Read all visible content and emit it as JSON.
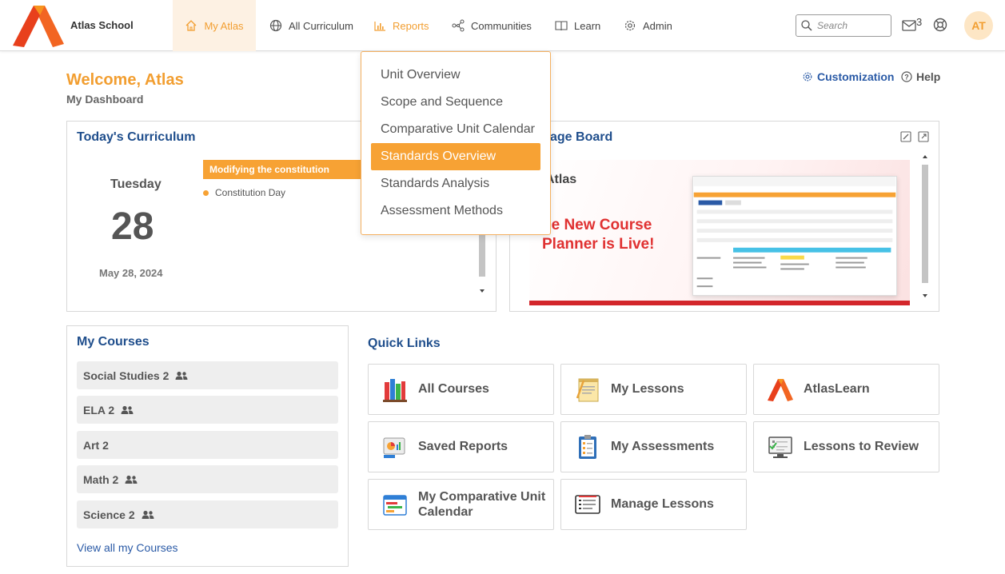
{
  "header": {
    "school_name": "Atlas School",
    "nav": [
      {
        "label": "My Atlas",
        "icon": "home-icon"
      },
      {
        "label": "All Curriculum",
        "icon": "globe-icon"
      },
      {
        "label": "Reports",
        "icon": "bar-chart-icon"
      },
      {
        "label": "Communities",
        "icon": "network-icon"
      },
      {
        "label": "Learn",
        "icon": "book-icon"
      },
      {
        "label": "Admin",
        "icon": "gear-icon"
      }
    ],
    "search_placeholder": "Search",
    "mail_count": "3",
    "avatar_initials": "AT",
    "colors": {
      "accent": "#f29e30",
      "active_bg": "#fdf1e3",
      "link": "#2a5aa6",
      "title": "#1f4e8c"
    }
  },
  "page": {
    "welcome": "Welcome, Atlas",
    "subtitle": "My Dashboard",
    "customization": "Customization",
    "help": "Help"
  },
  "reports_menu": {
    "items": [
      "Unit Overview",
      "Scope and Sequence",
      "Comparative Unit Calendar",
      "Standards Overview",
      "Standards Analysis",
      "Assessment Methods"
    ],
    "selected": "Standards Overview"
  },
  "todays_curriculum": {
    "title": "Today's Curriculum",
    "weekday": "Tuesday",
    "day": "28",
    "full_date": "May 28, 2024",
    "event_title": "Modifying the constitution",
    "event_item": "Constitution Day"
  },
  "message_board": {
    "title_visible": "age Board",
    "banner_brand": "Atlas",
    "banner_line1": "he New Course",
    "banner_line2": "Planner is Live!"
  },
  "my_courses": {
    "title": "My Courses",
    "courses": [
      {
        "name": "Social Studies 2",
        "shared": true
      },
      {
        "name": "ELA 2",
        "shared": true
      },
      {
        "name": "Art 2",
        "shared": false
      },
      {
        "name": "Math 2",
        "shared": true
      },
      {
        "name": "Science 2",
        "shared": true
      }
    ],
    "view_all": "View all my Courses"
  },
  "quick_links": {
    "title": "Quick Links",
    "links": [
      {
        "label": "All Courses",
        "icon": "books-icon"
      },
      {
        "label": "My Lessons",
        "icon": "lesson-notepad-icon"
      },
      {
        "label": "AtlasLearn",
        "icon": "atlas-logo-icon"
      },
      {
        "label": "Saved Reports",
        "icon": "saved-report-icon"
      },
      {
        "label": "My Assessments",
        "icon": "assessment-clipboard-icon"
      },
      {
        "label": "Lessons to Review",
        "icon": "review-screen-icon"
      },
      {
        "label": "My Comparative Unit Calendar",
        "icon": "calendar-icon"
      },
      {
        "label": "Manage Lessons",
        "icon": "manage-lessons-icon"
      }
    ]
  }
}
